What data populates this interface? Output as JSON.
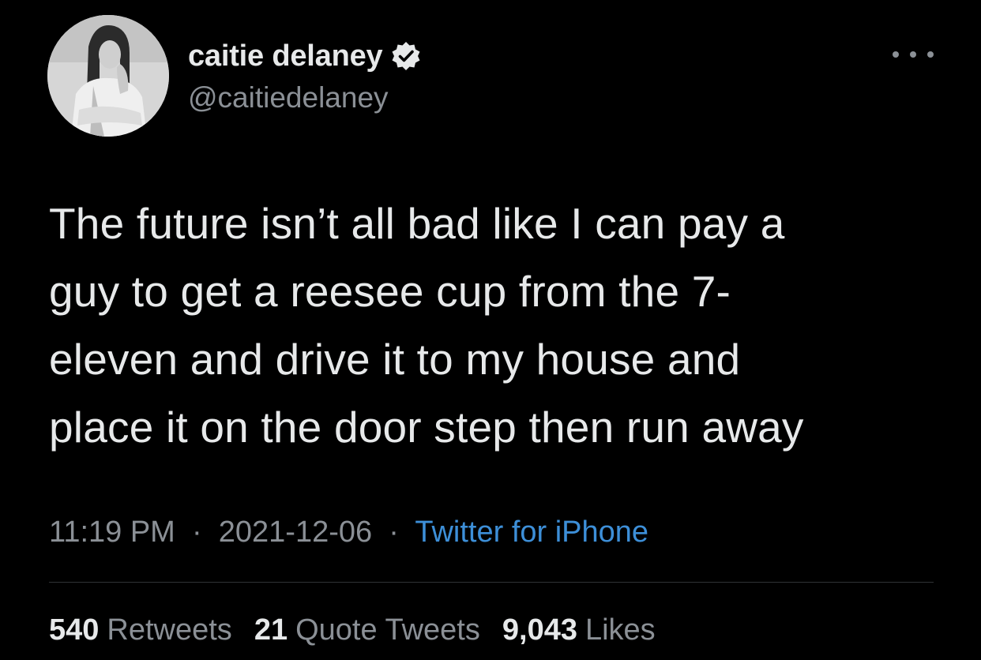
{
  "author": {
    "display_name": "caitie delaney",
    "handle": "@caitiedelaney",
    "verified": true,
    "avatar_icon": "profile-photo"
  },
  "tweet": {
    "text_lines": [
      "The future isn’t all bad like I can pay a",
      "guy to get a reesee cup from the 7-",
      "eleven and drive it to my house and",
      "place it on the door step then run away"
    ]
  },
  "meta": {
    "time": "11:19 PM",
    "separator": "·",
    "date": "2021-12-06",
    "source": "Twitter for iPhone"
  },
  "stats": {
    "retweets_count": "540",
    "retweets_label": "Retweets",
    "quotes_count": "21",
    "quotes_label": "Quote Tweets",
    "likes_count": "9,043",
    "likes_label": "Likes"
  },
  "colors": {
    "background": "#000000",
    "primary_text": "#e7e9ea",
    "secondary_text": "#8b9096",
    "link": "#3d8fd8",
    "divider": "#2f3336"
  }
}
